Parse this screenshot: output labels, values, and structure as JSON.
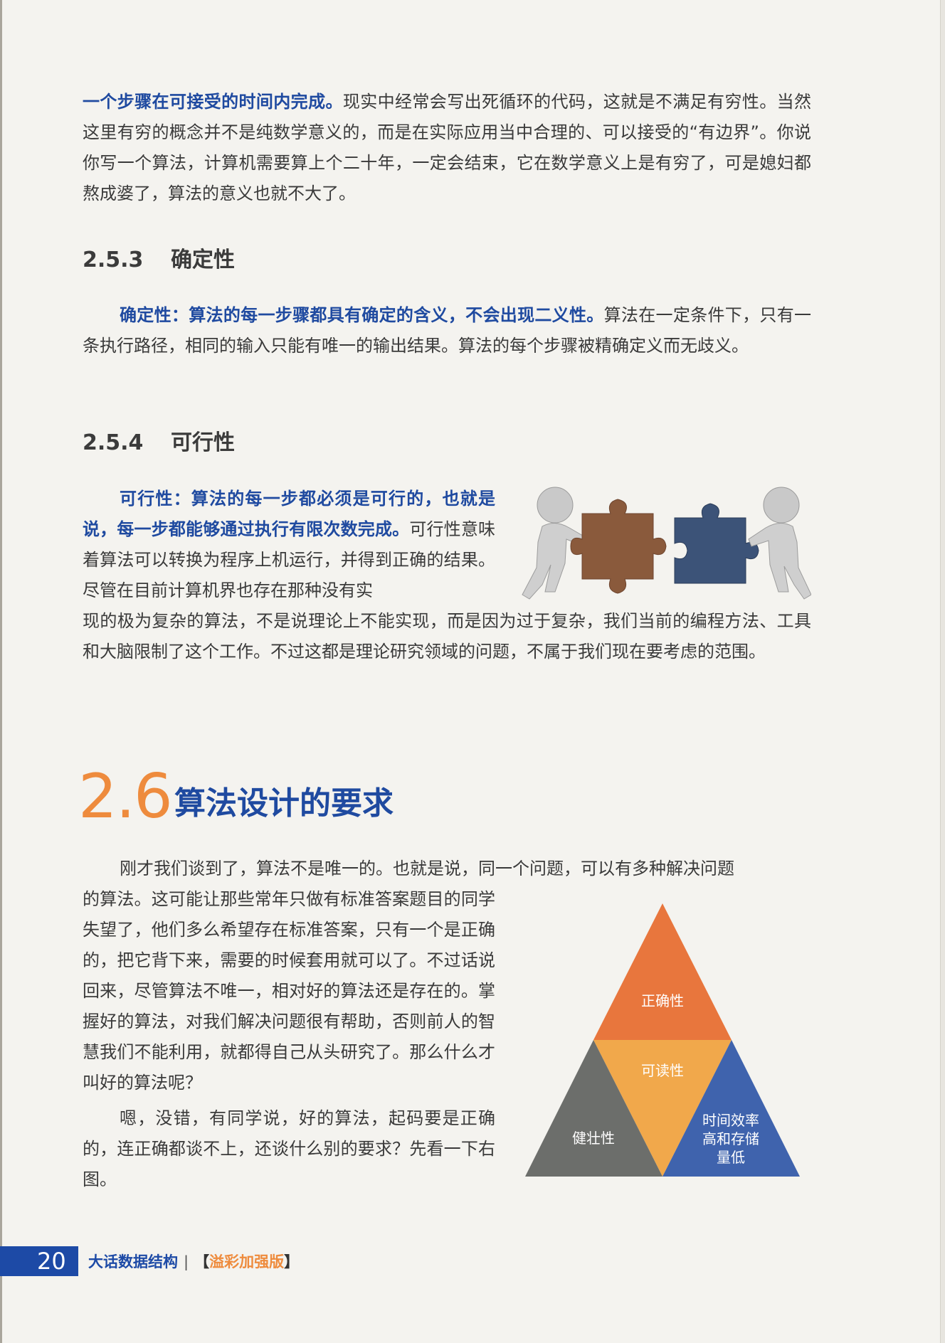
{
  "p1": {
    "emph": "一个步骤在可接受的时间内完成。",
    "rest": "现实中经常会写出死循环的代码，这就是不满足有穷性。当然这里有穷的概念并不是纯数学意义的，而是在实际应用当中合理的、可以接受的“有边界”。你说你写一个算法，计算机需要算上个二十年，一定会结束，它在数学意义上是有穷了，可是媳妇都熬成婆了，算法的意义也就不大了。"
  },
  "s253": {
    "number": "2.5.3",
    "title": "确定性",
    "emph": "确定性：算法的每一步骤都具有确定的含义，不会出现二义性。",
    "rest": "算法在一定条件下，只有一条执行路径，相同的输入只能有唯一的输出结果。算法的每个步骤被精确定义而无歧义。"
  },
  "s254": {
    "number": "2.5.4",
    "title": "可行性",
    "emph": "可行性：算法的每一步都必须是可行的，也就是说，每一步都能够通过执行有限次数完成。",
    "rest_narrow": "可行性意味着算法可以转换为程序上机运行，并得到正确的结果。尽管在目前计算机界也存在那种没有实",
    "rest_full": "现的极为复杂的算法，不是说理论上不能实现，而是因为过于复杂，我们当前的编程方法、工具和大脑限制了这个工作。不过这都是理论研究领域的问题，不属于我们现在要考虑的范围。"
  },
  "s26": {
    "number": "2.6",
    "title": "算法设计的要求",
    "intro": "刚才我们谈到了，算法不是唯一的。也就是说，同一个问题，可以有多种解决问题",
    "body1": "的算法。这可能让那些常年只做有标准答案题目的同学失望了，他们多么希望存在标准答案，只有一个是正确的，把它背下来，需要的时候套用就可以了。不过话说回来，尽管算法不唯一，相对好的算法还是存在的。掌握好的算法，对我们解决问题很有帮助，否则前人的智慧我们不能利用，就都得自己从头研究了。那么什么才叫好的算法呢？",
    "body2": "嗯，没错，有同学说，好的算法，起码要是正确的，连正确都谈不上，还谈什么别的要求？先看一下右图。"
  },
  "pyramid": {
    "top": "正确性",
    "middle": "可读性",
    "left": "健壮性",
    "right_lines": [
      "时间效率",
      "高和存储",
      "量低"
    ],
    "colors": {
      "top": "#e8763d",
      "middle": "#f1a84b",
      "left": "#6c6e6b",
      "right": "#3f63ad"
    }
  },
  "puzzle_icons": [
    "figure-left-icon",
    "puzzle-piece-brown-icon",
    "puzzle-piece-blue-icon",
    "figure-right-icon"
  ],
  "footer": {
    "page": "20",
    "book": "大话数据结构",
    "sep": "|",
    "bracket_open": "【",
    "edition": "溢彩加强版",
    "bracket_close": "】"
  }
}
